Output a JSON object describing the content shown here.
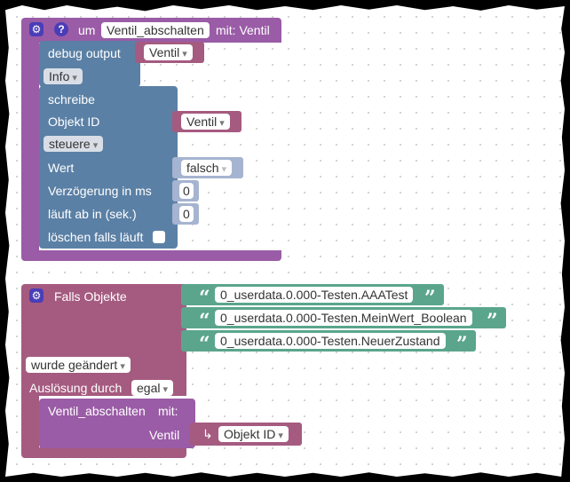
{
  "procedure": {
    "prefix": "um",
    "name": "Ventil_abschalten",
    "suffix": "mit: Ventil",
    "debug_label": "debug output",
    "debug_var": "Ventil",
    "level": "Info",
    "write_block": {
      "title": "schreibe",
      "object_id_label": "Objekt ID",
      "object_id_var": "Ventil",
      "mode": "steuere",
      "value_label": "Wert",
      "value": "falsch",
      "delay_label": "Verzögerung in ms",
      "delay": "0",
      "expires_label": "läuft ab in (sek.)",
      "expires": "0",
      "clear_label": "löschen falls läuft"
    }
  },
  "trigger": {
    "title": "Falls Objekte",
    "objects": [
      "0_userdata.0.000-Testen.AAATest",
      "0_userdata.0.000-Testen.MeinWert_Boolean",
      "0_userdata.0.000-Testen.NeuerZustand"
    ],
    "condition": "wurde geändert",
    "trigger_label": "Auslösung durch",
    "trigger_value": "egal",
    "call": {
      "name": "Ventil_abschalten",
      "with": "mit:",
      "param_label": "Ventil",
      "param_icon": "↳",
      "param_value": "Objekt ID"
    }
  },
  "colors": {
    "procedure": "#9a5ca6",
    "system": "#5b80a5",
    "variable": "#a55b80",
    "text": "#5ba58c",
    "logic": "#a5b4d0",
    "trigger": "#a55b80"
  },
  "icons": {
    "settings": "gear-icon",
    "help": "help-icon",
    "quote_open": "“",
    "quote_close": "”"
  }
}
